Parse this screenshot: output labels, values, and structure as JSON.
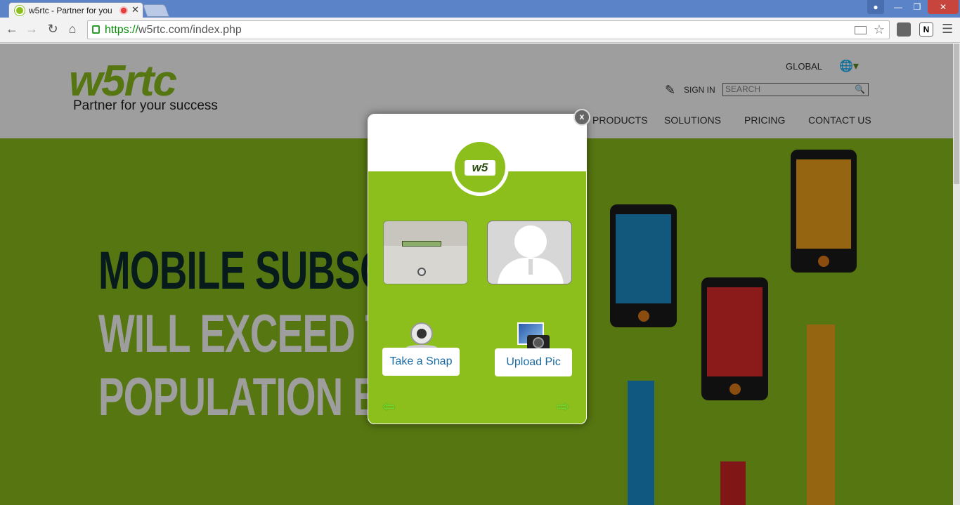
{
  "browser": {
    "tab_title": "w5rtc - Partner for you",
    "tab_close": "✕",
    "url_scheme": "https://",
    "url_rest": "w5rtc.com/index.php"
  },
  "site": {
    "logo": "w5rtc",
    "tagline": "Partner for your success",
    "global_label": "GLOBAL",
    "signin_label": "SIGN IN",
    "search_placeholder": "SEARCH",
    "nav": [
      "PRODUCTS",
      "SOLUTIONS",
      "PRICING",
      "CONTACT US"
    ],
    "hero_lines": [
      "MOBILE SUBSC",
      "WILL EXCEED TI",
      "POPULATION BY"
    ]
  },
  "modal": {
    "close_label": "x",
    "logo_text": "w5",
    "take_snap_label": "Take a Snap",
    "upload_pic_label": "Upload Pic",
    "prev_arrow": "⇦",
    "next_arrow": "⇨"
  },
  "colors": {
    "brand_green": "#8cbf1c",
    "button_text_blue": "#1a6aa3"
  }
}
